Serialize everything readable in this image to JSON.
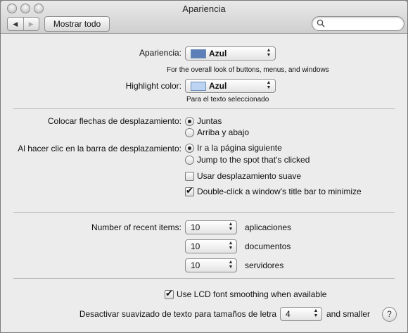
{
  "window": {
    "title": "Apariencia"
  },
  "toolbar": {
    "back_icon": "◀",
    "forward_icon": "▶",
    "show_all_label": "Mostrar todo",
    "search_value": ""
  },
  "appearance": {
    "label": "Apariencia:",
    "value": "Azul",
    "swatch_color": "#5b7fb6",
    "hint": "For the overall look of buttons, menus, and windows"
  },
  "highlight": {
    "label": "Highlight color:",
    "value": "Azul",
    "swatch_color": "#bcd4f2",
    "hint": "Para el texto seleccionado"
  },
  "scroll_arrows": {
    "label": "Colocar flechas de desplazamiento:",
    "options": [
      "Juntas",
      "Arriba y abajo"
    ],
    "selected": "Juntas"
  },
  "scroll_click": {
    "label": "Al hacer clic en la barra de desplazamiento:",
    "options": [
      "Ir a la página siguiente",
      "Jump to the spot that's clicked"
    ],
    "selected": "Ir a la página siguiente"
  },
  "smooth_scrolling": {
    "label": "Usar desplazamiento suave",
    "checked": false
  },
  "double_click_minimize": {
    "label": "Double-click a window's title bar to minimize",
    "checked": true
  },
  "recent_items": {
    "label": "Number of recent items:",
    "rows": [
      {
        "value": "10",
        "label": "aplicaciones"
      },
      {
        "value": "10",
        "label": "documentos"
      },
      {
        "value": "10",
        "label": "servidores"
      }
    ]
  },
  "lcd_smoothing": {
    "label": "Use LCD font smoothing when available",
    "checked": true
  },
  "font_smoothing": {
    "label": "Desactivar suavizado de texto para tamaños de letra",
    "value": "4",
    "suffix": "and smaller"
  },
  "help_label": "?"
}
